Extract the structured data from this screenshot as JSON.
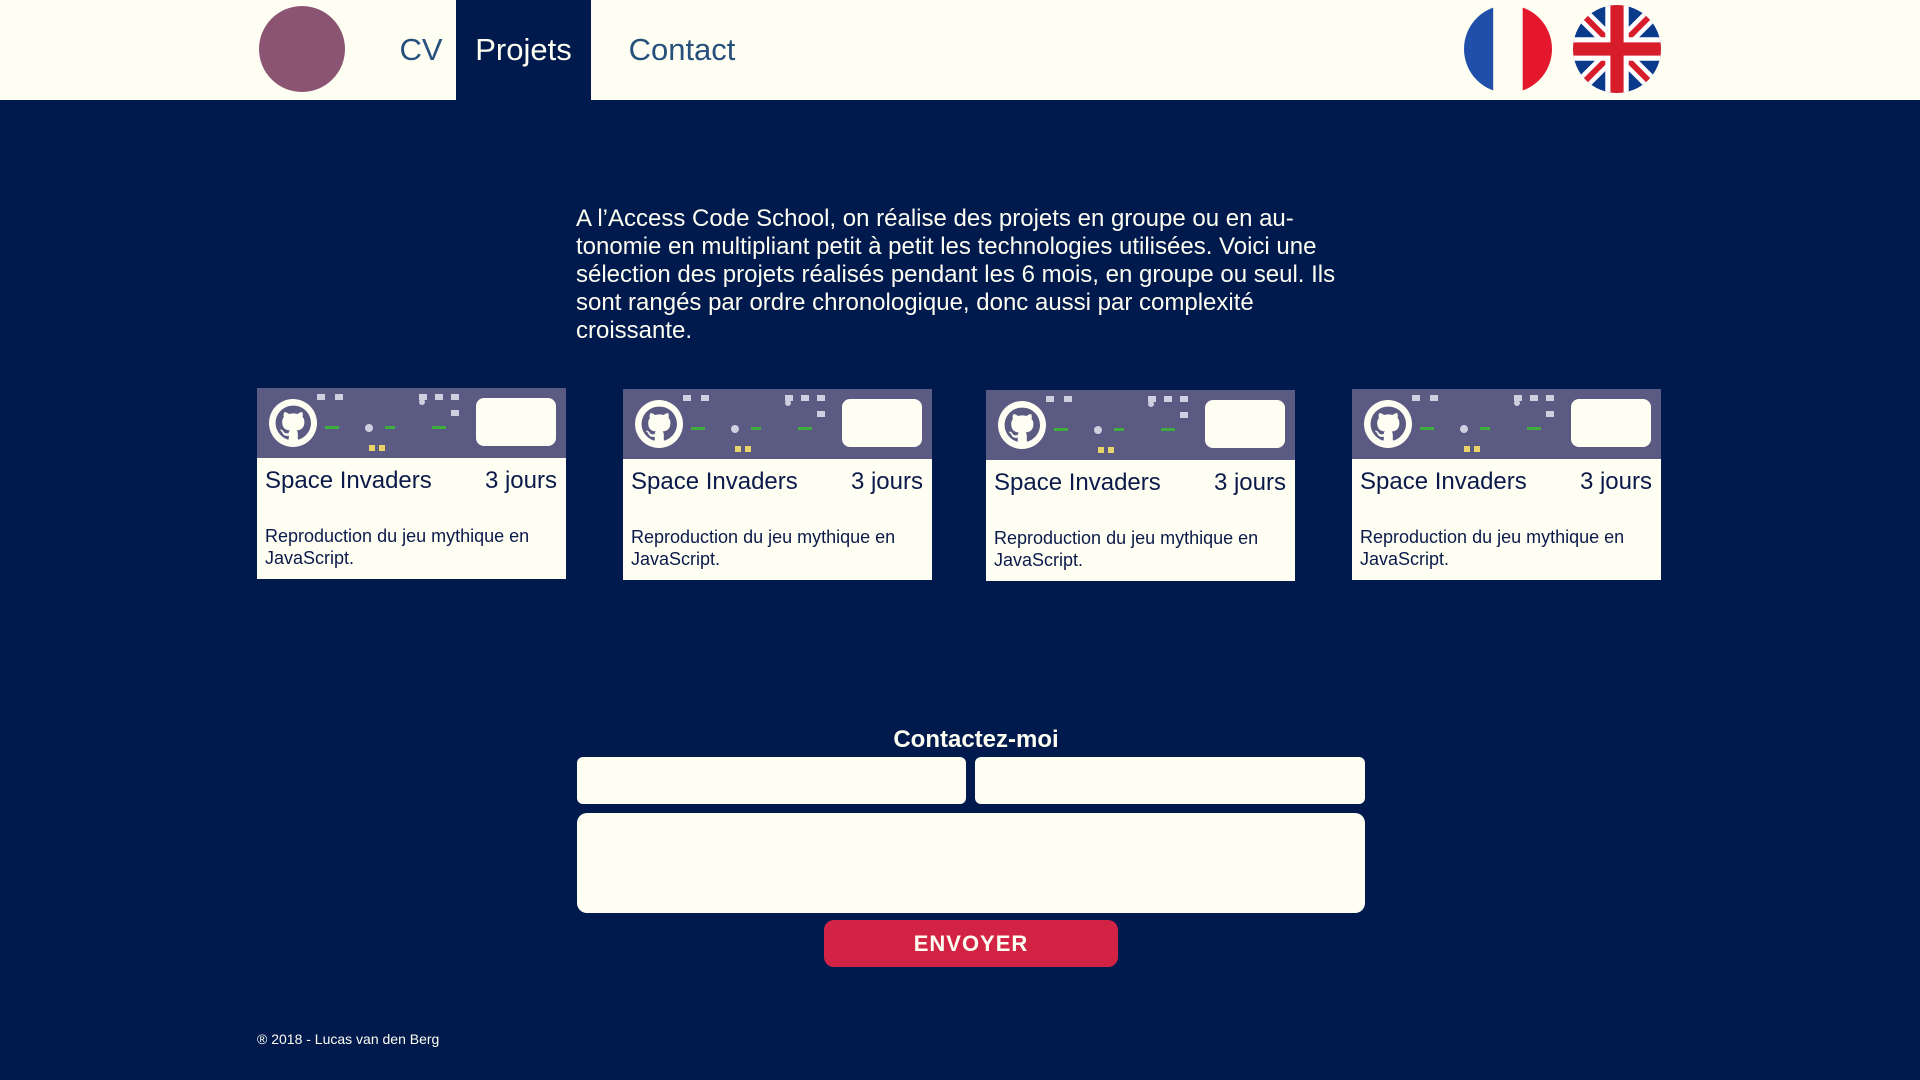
{
  "nav": {
    "items": [
      {
        "label": "CV"
      },
      {
        "label": "Projets"
      },
      {
        "label": "Contact"
      }
    ],
    "active": "Projets"
  },
  "languages": [
    "french-flag-icon",
    "uk-flag-icon"
  ],
  "intro": "A l’Access Code School, on  réalise des projets en groupe ou en au-tonomie en multipliant petit à petit les technologies utilisées. Voici une sélection des projets réalisés pendant les 6 mois, en groupe ou seul. Ils sont rangés par ordre chronologique, donc aussi par complexité croissante.",
  "projects": [
    {
      "title": "Space Invaders",
      "duration": "3 jours",
      "description": "Reproduction du jeu mythique en JavaScript.",
      "icon": "github-icon"
    },
    {
      "title": "Space Invaders",
      "duration": "3 jours",
      "description": "Reproduction du jeu mythique en JavaScript.",
      "icon": "github-icon"
    },
    {
      "title": "Space Invaders",
      "duration": "3 jours",
      "description": "Reproduction du jeu mythique en JavaScript.",
      "icon": "github-icon"
    },
    {
      "title": "Space Invaders",
      "duration": "3 jours",
      "description": "Reproduction du jeu mythique en JavaScript.",
      "icon": "github-icon"
    }
  ],
  "contact": {
    "title": "Contactez-moi",
    "name_value": "",
    "email_value": "",
    "message_value": "",
    "send_label": "ENVOYER"
  },
  "footer": "® 2018 - Lucas van den Berg",
  "colors": {
    "background": "#001a4d",
    "header": "#fefef2",
    "accent": "#d22345",
    "avatar": "#8b5472"
  }
}
